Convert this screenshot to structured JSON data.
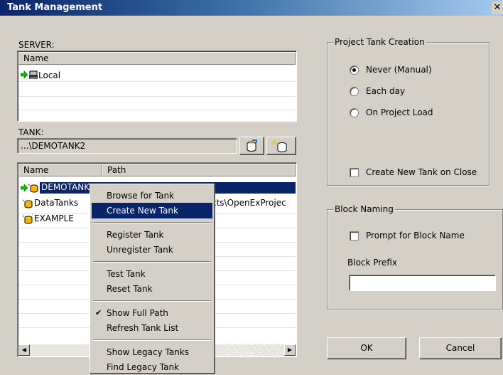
{
  "window": {
    "title": "Tank Management",
    "close_glyph": "✕"
  },
  "server": {
    "label": "SERVER:",
    "column_name": "Name",
    "items": [
      {
        "name": "Local",
        "icon": "server-icon"
      }
    ]
  },
  "tank": {
    "label": "TANK:",
    "path_value": "...\\DEMOTANK2",
    "browse_icon": "browse-tank-icon",
    "new_icon": "new-tank-icon",
    "columns": {
      "name": "Name",
      "path": "Path"
    },
    "rows": [
      {
        "name": "DEMOTANK",
        "path": "",
        "selected": true
      },
      {
        "name": "DataTanks",
        "path": "cts\\OpenExProjec",
        "selected": false
      },
      {
        "name": "EXAMPLE",
        "path": "",
        "selected": false
      }
    ]
  },
  "context_menu": {
    "items": [
      {
        "label": "Browse for Tank"
      },
      {
        "label": "Create New Tank",
        "highlighted": true
      },
      {
        "label": "Register Tank"
      },
      {
        "label": "Unregister Tank"
      },
      {
        "label": "Test Tank"
      },
      {
        "label": "Reset Tank"
      },
      {
        "label": "Show Full Path",
        "checked": true
      },
      {
        "label": "Refresh Tank List"
      },
      {
        "label": "Show Legacy Tanks"
      },
      {
        "label": "Find Legacy Tank"
      }
    ]
  },
  "project_tank_creation": {
    "title": "Project Tank Creation",
    "options": [
      {
        "label": "Never (Manual)",
        "checked": true
      },
      {
        "label": "Each day",
        "checked": false
      },
      {
        "label": "On Project Load",
        "checked": false
      }
    ],
    "create_on_close": {
      "label": "Create New Tank on Close",
      "checked": false
    }
  },
  "block_naming": {
    "title": "Block Naming",
    "prompt": {
      "label": "Prompt for Block Name",
      "checked": false
    },
    "prefix_label": "Block Prefix",
    "prefix_value": ""
  },
  "buttons": {
    "ok": "OK",
    "cancel": "Cancel"
  }
}
